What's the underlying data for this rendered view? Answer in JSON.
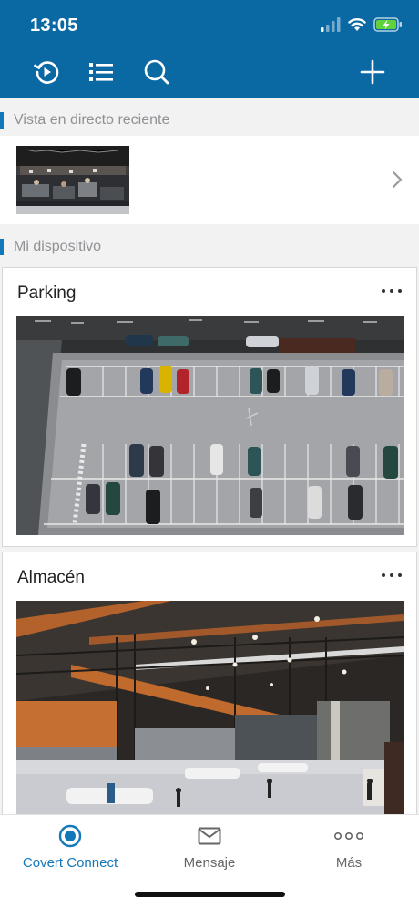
{
  "colors": {
    "brand": "#0a68a3",
    "accent": "#1378b9",
    "battery": "#5fd23c"
  },
  "status_bar": {
    "time": "13:05",
    "icons": [
      "signal-icon",
      "wifi-icon",
      "battery-charging-icon"
    ]
  },
  "toolbar": {
    "icons": [
      "playback-icon",
      "device-list-icon",
      "search-icon",
      "add-icon"
    ]
  },
  "recent_section": {
    "title": "Vista en directo reciente",
    "items": [
      {
        "thumbnail": "office-live-view"
      }
    ]
  },
  "device_section": {
    "title": "Mi dispositivo",
    "devices": [
      {
        "name": "Parking",
        "preview": "parking-lot-camera"
      },
      {
        "name": "Almacén",
        "preview": "warehouse-camera"
      }
    ]
  },
  "tabbar": {
    "tabs": [
      {
        "label": "Covert Connect",
        "icon": "camera-icon",
        "active": true
      },
      {
        "label": "Mensaje",
        "icon": "envelope-icon",
        "active": false
      },
      {
        "label": "Más",
        "icon": "more-dots-icon",
        "active": false
      }
    ]
  }
}
